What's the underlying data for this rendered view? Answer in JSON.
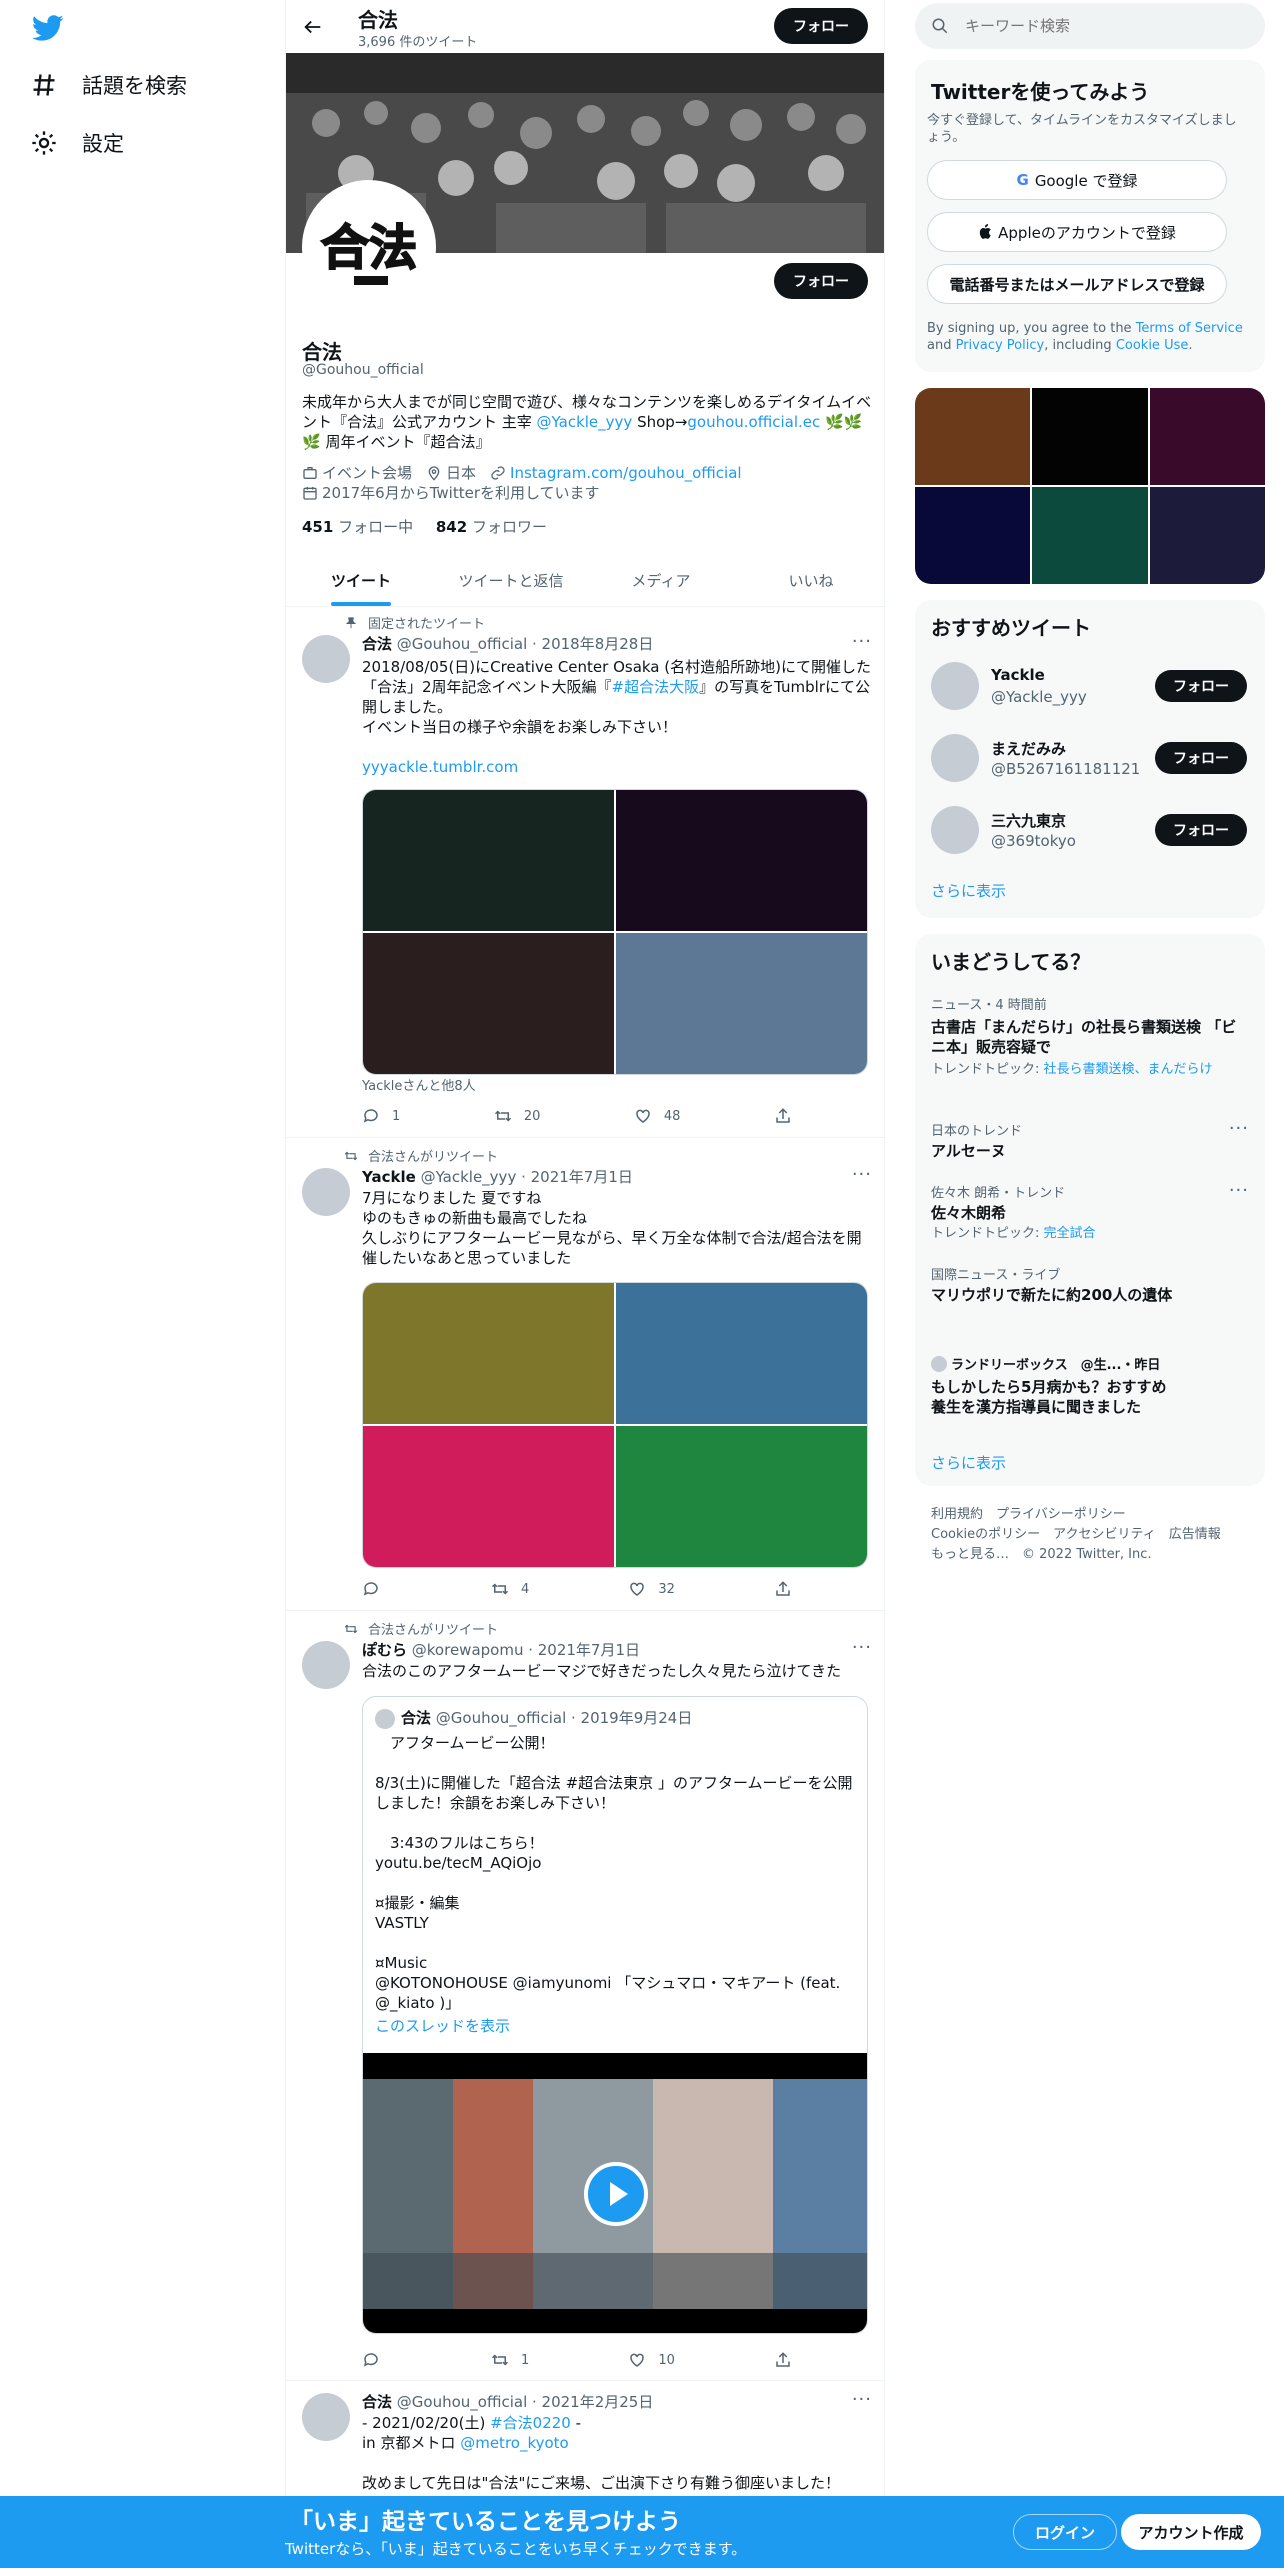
{
  "nav": {
    "explore": "話題を検索",
    "settings": "設定"
  },
  "header": {
    "title": "合法",
    "tweet_count": "3,696 件のツイート",
    "follow": "フォロー"
  },
  "profile": {
    "name": "合法",
    "handle": "@Gouhou_official",
    "follow": "フォロー",
    "bio_1": "未成年から大人までが同じ空間で遊び、様々なコンテンツを楽しめるデイタイムイベント『合法』公式アカウント 主宰 ",
    "bio_mention": "@Yackle_yyy",
    "bio_2": " Shop→",
    "bio_link": "gouhou.official.ec",
    "bio_3": " 🌿🌿🌿 周年イベント『超合法』",
    "category": "イベント会場",
    "location": "日本",
    "website": "Instagram.com/gouhou_official",
    "joined": "2017年6月からTwitterを利用しています",
    "following_count": "451",
    "following_label": " フォロー中",
    "followers_count": "842",
    "followers_label": " フォロワー"
  },
  "tabs": [
    "ツイート",
    "ツイートと返信",
    "メディア",
    "いいね"
  ],
  "tweets": [
    {
      "context": "固定されたツイート",
      "name": "合法",
      "meta": " @Gouhou_official · 2018年8月28日",
      "text_1": "2018/08/05(日)にCreative Center Osaka (名村造船所跡地)にて開催した「合法」2周年記念イベント大阪編『",
      "text_hashtag": "#超合法大阪",
      "text_2": "』の写真をTumblrにて公開しました。\nイベント当日の様子や余韻をお楽しみ下さい！",
      "link": "yyyackle.tumblr.com",
      "colors": [
        "#172521",
        "#170a1d",
        "#2b1e1e",
        "#5d7894"
      ],
      "tagged": "Yackleさんと他8人",
      "replies": "1",
      "retweets": "20",
      "likes": "48"
    },
    {
      "context": "合法さんがリツイート",
      "name": "Yackle",
      "meta": " @Yackle_yyy · 2021年7月1日",
      "text": "7月になりました 夏ですね\nゆのもきゅの新曲も最高でしたね\n久しぶりにアフタームービー見ながら、早く万全な体制で合法/超合法を開催したいなあと思っていました",
      "colors": [
        "#7e772b",
        "#3c7199",
        "#d01c5a",
        "#1f8640"
      ],
      "replies": "",
      "retweets": "4",
      "likes": "32"
    },
    {
      "context": "合法さんがリツイート",
      "name": "ぽむら",
      "meta": "   @korewapomu · 2021年7月1日",
      "text": "合法のこのアフタームービーマジで好きだったし久々見たら泣けてきた",
      "quote_name": "合法",
      "quote_meta": " @Gouhou_official · 2019年9月24日",
      "quote_text": "　アフタームービー公開！\n\n8/3(土)に開催した「超合法 #超合法東京 」のアフタームービーを公開しました！余韻をお楽しみ下さい！\n\n　3:43のフルはこちら！\nyoutu.be/tecM_AQiOjo\n\n¤撮影・編集\nVASTLY\n\n¤Music\n@KOTONOHOUSE @iamyunomi 「マシュマロ・マキアート (feat. @_kiato )」",
      "thread": "このスレッドを表示",
      "replies": "",
      "retweets": "1",
      "likes": "10"
    },
    {
      "name": "合法",
      "meta": " @Gouhou_official · 2021年2月25日",
      "line1": "- 2021/02/20(土) ",
      "line1_tag": "#合法0220",
      "line1_end": " -",
      "line2": "in 京都メトロ ",
      "line2_mention": "@metro_kyoto",
      "line3": "改めまして先日は\"合法\"にご来場、ご出演下さり有難う御座いました！"
    }
  ],
  "sidebar": {
    "search_placeholder": "キーワード検索",
    "signup_title": "Twitterを使ってみよう",
    "signup_sub": "今すぐ登録して、タイムラインをカスタマイズしましょう。",
    "google_btn": "Google で登録",
    "apple_btn": "Appleのアカウントで登録",
    "phone_btn": "電話番号またはメールアドレスで登録",
    "terms_1": "By signing up, you agree to the ",
    "terms_link": "Terms of Service",
    "terms_2": " and ",
    "privacy_link": "Privacy Policy",
    "terms_3": ", including ",
    "cookie_link": "Cookie Use",
    "terms_4": ".",
    "media_colors": [
      "#6b3a1a",
      "#030303",
      "#3a0a2a",
      "#090939",
      "#0b4a3c",
      "#1c1c3a"
    ],
    "wtf_title": "おすすめツイート",
    "wtf": [
      {
        "name": "Yackle",
        "handle": "@Yackle_yyy",
        "btn": "フォロー"
      },
      {
        "name": "まえだみみ",
        "handle": "@B5267161181121",
        "btn": "フォロー"
      },
      {
        "name": "三六九東京",
        "handle": "@369tokyo",
        "btn": "フォロー"
      }
    ],
    "show_more": "さらに表示",
    "trends_title": "いまどうしてる？",
    "trends": [
      {
        "meta": "ニュース・4 時間前",
        "name": "古書店「まんだらけ」の社長ら書類送検 「ビニ本」販売容疑で",
        "sub_1": "トレンドトピック: ",
        "sub_link": "社長ら書類送検、まんだらけ"
      },
      {
        "meta": "日本のトレンド",
        "name": "アルセーヌ"
      },
      {
        "meta": "佐々木 朗希・トレンド",
        "name": "佐々木朗希",
        "sub_1": "トレンドトピック: ",
        "sub_link": "完全試合"
      },
      {
        "meta": "国際ニュース・ライブ",
        "name": "マリウポリで新たに約200人の遺体"
      },
      {
        "meta": "ランドリーボックス　@生...・昨日",
        "name": "もしかしたら5月病かも？おすすめ養生を漢方指導員に聞きました"
      }
    ],
    "trends_more": "さらに表示",
    "footer_1": "利用規約　プライバシーポリシー",
    "footer_2": "Cookieのポリシー　アクセシビリティ　広告情報",
    "footer_3": "もっと見る…　© 2022 Twitter, Inc."
  },
  "bottom": {
    "headline": "「いま」起きていることを見つけよう",
    "sub": "Twitterなら、「いま」起きていることをいち早くチェックできます。",
    "login": "ログイン",
    "signup": "アカウント作成"
  }
}
